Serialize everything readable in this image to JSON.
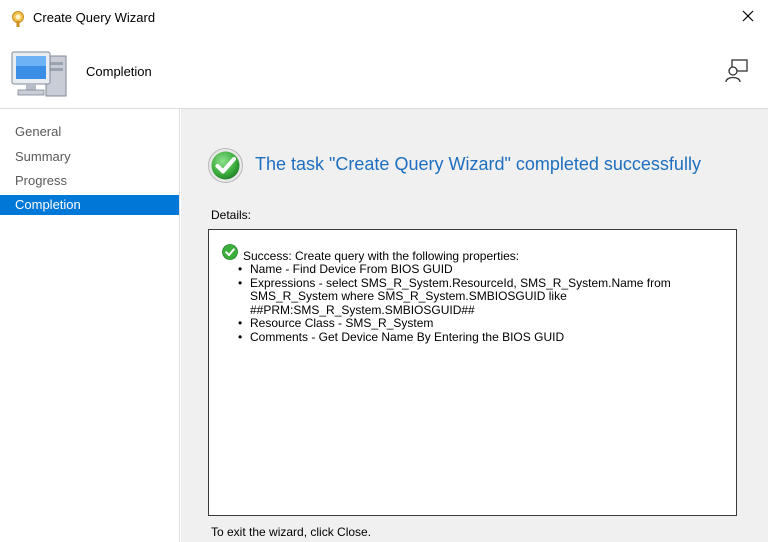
{
  "window": {
    "title": "Create Query Wizard"
  },
  "header": {
    "title": "Completion"
  },
  "nav": {
    "items": [
      {
        "label": "General",
        "selected": false
      },
      {
        "label": "Summary",
        "selected": false
      },
      {
        "label": "Progress",
        "selected": false
      },
      {
        "label": "Completion",
        "selected": true
      }
    ]
  },
  "main": {
    "status": "The task \"Create Query Wizard\" completed successfully",
    "details_label": "Details:",
    "details": {
      "success_line": "Success: Create query with the following properties:",
      "properties": [
        "Name - Find Device From BIOS GUID",
        "Expressions - select SMS_R_System.ResourceId, SMS_R_System.Name from SMS_R_System where SMS_R_System.SMBIOSGUID like ##PRM:SMS_R_System.SMBIOSGUID##",
        "Resource Class - SMS_R_System",
        "Comments - Get Device Name By Entering the BIOS GUID"
      ]
    },
    "exit_text": "To exit the wizard, click Close."
  },
  "colors": {
    "accent": "#0078d7",
    "status_text": "#1e6fc0",
    "success_green": "#3cae3c",
    "content_bg": "#f0f0f0"
  },
  "icons": {
    "app": "query-wizard-icon",
    "header": "computer-icon",
    "help": "person-chat-icon",
    "status": "green-check-icon"
  }
}
